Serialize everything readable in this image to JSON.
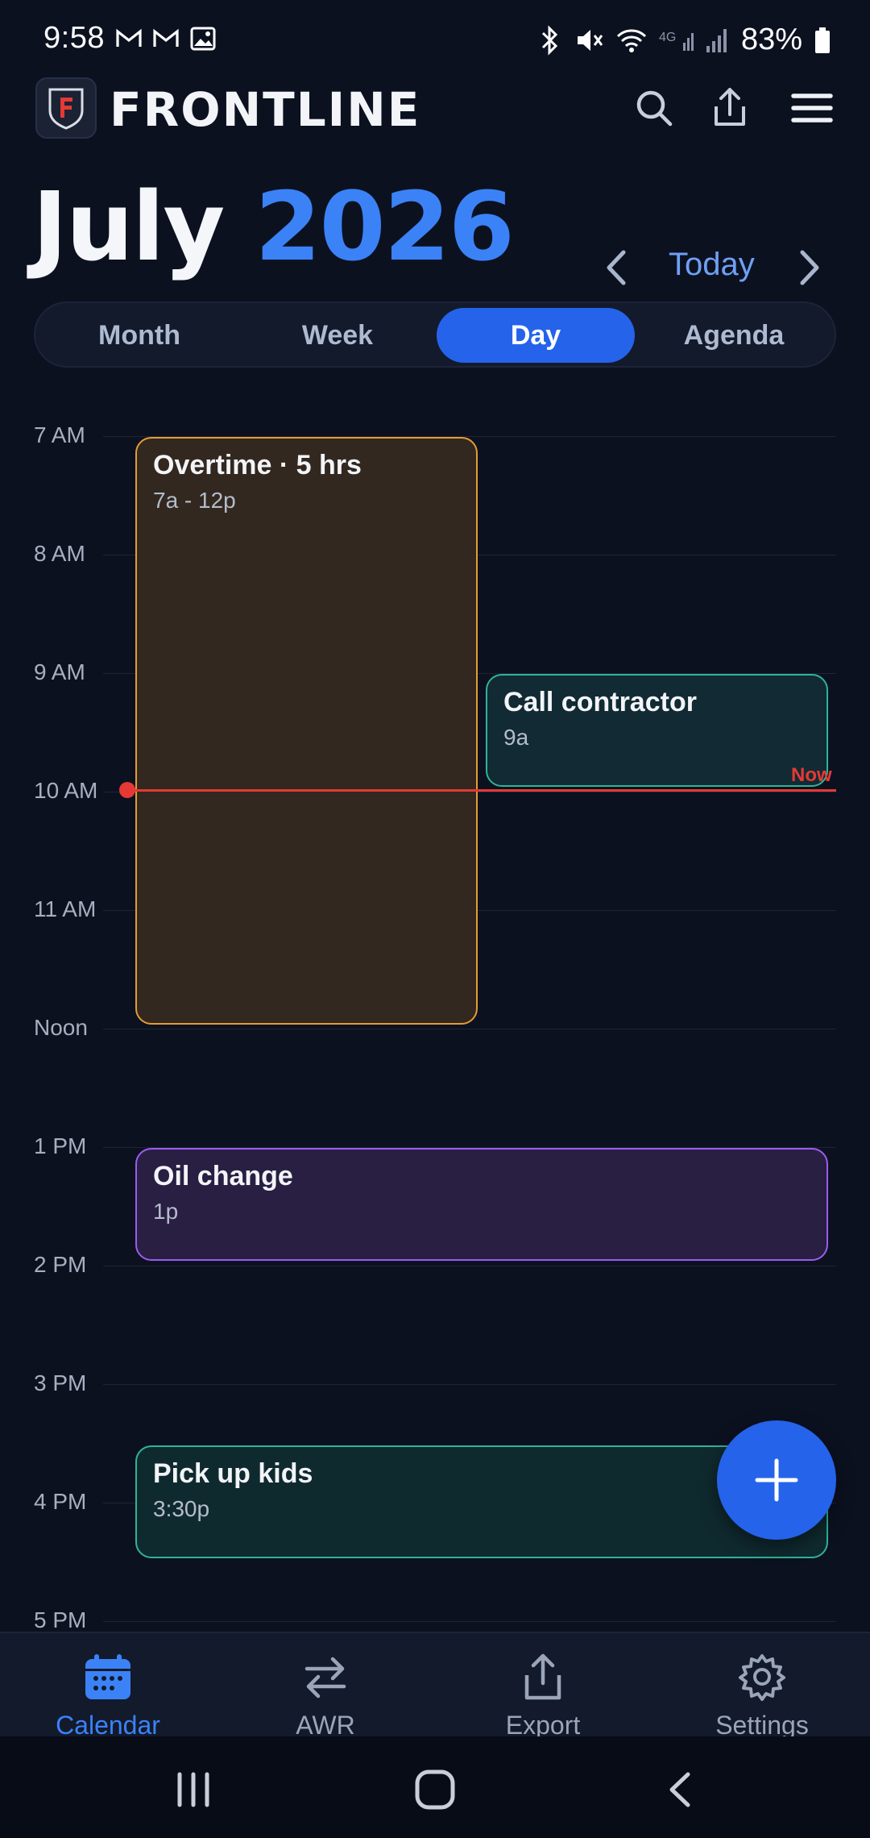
{
  "status": {
    "time": "9:58",
    "battery": "83%",
    "network": "4G"
  },
  "app": {
    "brand": "FRONTLINE",
    "logo_letter": "F"
  },
  "header": {
    "month": "July",
    "year": "2026",
    "today_label": "Today"
  },
  "tabs": [
    {
      "label": "Month",
      "active": false
    },
    {
      "label": "Week",
      "active": false
    },
    {
      "label": "Day",
      "active": true
    },
    {
      "label": "Agenda",
      "active": false
    }
  ],
  "hours": [
    "7 AM",
    "8 AM",
    "9 AM",
    "10 AM",
    "11 AM",
    "Noon",
    "1 PM",
    "2 PM",
    "3 PM",
    "4 PM",
    "5 PM"
  ],
  "now_label": "Now",
  "events": {
    "overtime": {
      "title": "Overtime · 5 hrs",
      "time": "7a - 12p",
      "color": "#e59b35"
    },
    "call": {
      "title": "Call contractor",
      "time": "9a",
      "color": "#2fb39a"
    },
    "oil": {
      "title": "Oil change",
      "time": "1p",
      "color": "#9d5cf0"
    },
    "kids": {
      "title": "Pick up kids",
      "time": "3:30p",
      "color": "#2fb39a"
    }
  },
  "bottom_nav": [
    {
      "label": "Calendar",
      "icon": "calendar-icon",
      "active": true
    },
    {
      "label": "AWR",
      "icon": "swap-icon",
      "active": false
    },
    {
      "label": "Export",
      "icon": "export-icon",
      "active": false
    },
    {
      "label": "Settings",
      "icon": "gear-icon",
      "active": false
    }
  ],
  "colors": {
    "accent": "#2563eb",
    "now_line": "#e53935",
    "background": "#0c1120"
  }
}
